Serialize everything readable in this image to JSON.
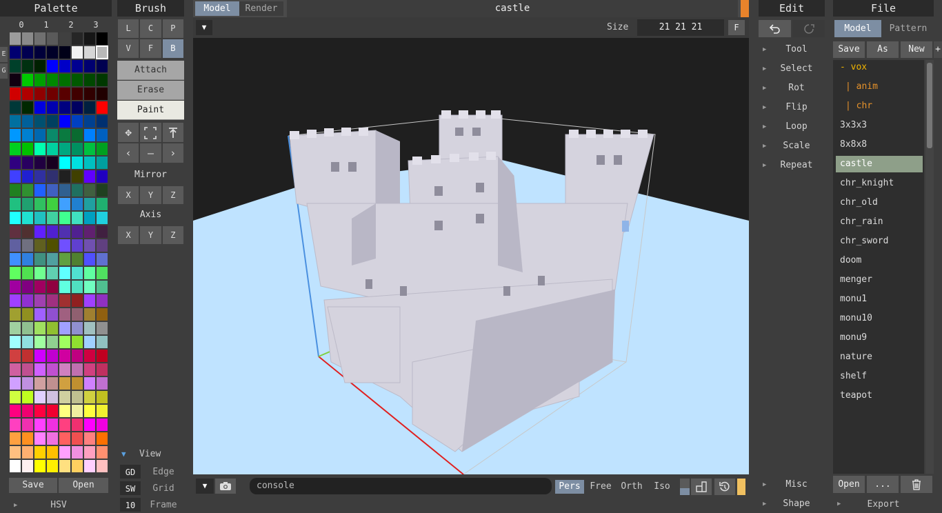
{
  "palette": {
    "title": "Palette",
    "tabs": [
      "0",
      "1",
      "2",
      "3"
    ],
    "side_tabs": [
      "E",
      "G"
    ],
    "colors": [
      "#9c9c9c",
      "#8a8a8a",
      "#707070",
      "#5a5a5a",
      "#404040",
      "#262626",
      "#161616",
      "#000000",
      "#000070",
      "#000050",
      "#00003a",
      "#000028",
      "#000018",
      "#f2f2f2",
      "#d6d6d6",
      "#b8b8b8",
      "#00402a",
      "#003010",
      "#002000",
      "#0000ff",
      "#0000c8",
      "#000090",
      "#000070",
      "#000050",
      "#100010",
      "#00c800",
      "#00a000",
      "#008800",
      "#007000",
      "#005800",
      "#004800",
      "#003800",
      "#d00000",
      "#b00000",
      "#900000",
      "#700000",
      "#580000",
      "#400000",
      "#300000",
      "#200000",
      "#003838",
      "#002800",
      "#0000e0",
      "#0000b0",
      "#000080",
      "#000060",
      "#002040",
      "#ff0000",
      "#0070a0",
      "#00609a",
      "#005070",
      "#004060",
      "#0000ff",
      "#0040c0",
      "#004090",
      "#003070",
      "#0098ff",
      "#0080d0",
      "#0068b0",
      "#0a8a6a",
      "#0a7a40",
      "#0a6a30",
      "#0080ff",
      "#0060c0",
      "#00d020",
      "#00c000",
      "#00ffb0",
      "#00d0a0",
      "#00a880",
      "#009060",
      "#00c040",
      "#00a020",
      "#300080",
      "#280060",
      "#200040",
      "#180020",
      "#00ffff",
      "#00e0e0",
      "#00c0c0",
      "#00a0a0",
      "#4040ff",
      "#2020d0",
      "#3030a0",
      "#303070",
      "#202020",
      "#404000",
      "#6000ff",
      "#2000c0",
      "#208020",
      "#309030",
      "#2060ff",
      "#4060c0",
      "#306090",
      "#207060",
      "#406040",
      "#204020",
      "#20c080",
      "#20a070",
      "#30c060",
      "#40d040",
      "#40a0ff",
      "#2080d0",
      "#20a0a0",
      "#20b070",
      "#20ffff",
      "#20e0d0",
      "#20c0c0",
      "#40d0a0",
      "#40ff90",
      "#40e0c0",
      "#00a0c0",
      "#20d0e0",
      "#603040",
      "#503030",
      "#6020ff",
      "#5020d0",
      "#5030b0",
      "#502090",
      "#602070",
      "#402040",
      "#6060a0",
      "#707080",
      "#606020",
      "#505000",
      "#7050ff",
      "#6040d0",
      "#7050b0",
      "#604080",
      "#4090ff",
      "#3080e0",
      "#409080",
      "#50a0a0",
      "#60a040",
      "#508030",
      "#5050ff",
      "#6070d0",
      "#60ff60",
      "#50e050",
      "#70ff90",
      "#60d0b0",
      "#60ffff",
      "#50e0d0",
      "#60ffa0",
      "#50e060",
      "#a000a0",
      "#800080",
      "#a00060",
      "#900040",
      "#60ffe0",
      "#50e0c0",
      "#70ffc0",
      "#50c090",
      "#a040ff",
      "#9030d0",
      "#a040b0",
      "#a03080",
      "#a03030",
      "#902020",
      "#a040ff",
      "#9030c0",
      "#a0a030",
      "#909020",
      "#a060ff",
      "#9050d0",
      "#a06080",
      "#906070",
      "#a08030",
      "#906010",
      "#a0d0a0",
      "#90c090",
      "#a0e060",
      "#90c030",
      "#a0a0ff",
      "#9090d0",
      "#a0c0c0",
      "#909090",
      "#a0ffff",
      "#90e0e0",
      "#a0ffa0",
      "#90d090",
      "#a0ff60",
      "#90e030",
      "#a0d0ff",
      "#90c0c0",
      "#d04040",
      "#c03030",
      "#d000ff",
      "#c000d0",
      "#d000a0",
      "#c00080",
      "#d00040",
      "#c00020",
      "#d060a0",
      "#c05090",
      "#d060ff",
      "#c050d0",
      "#d080c0",
      "#c070b0",
      "#d04080",
      "#c03060",
      "#d0a0ff",
      "#c090e0",
      "#d0a0a0",
      "#c09090",
      "#d0a040",
      "#c09030",
      "#d080ff",
      "#c070d0",
      "#d0ff40",
      "#c0ff20",
      "#e0d0ff",
      "#d0c0e0",
      "#d0d0a0",
      "#c0c090",
      "#d0d040",
      "#c0c020",
      "#ff0080",
      "#f00070",
      "#ff0040",
      "#f00030",
      "#ffff80",
      "#f0f0a0",
      "#ffff40",
      "#f0f030",
      "#ff40c0",
      "#f030b0",
      "#ff40ff",
      "#f030e0",
      "#ff4080",
      "#f03070",
      "#ff00ff",
      "#f000e0",
      "#ffa040",
      "#ff9020",
      "#ff80ff",
      "#f070e0",
      "#ff6060",
      "#f05050",
      "#ff8080",
      "#ff7000",
      "#ffc080",
      "#ffb070",
      "#ffd000",
      "#ffc000",
      "#ffa0ff",
      "#f090e0",
      "#ffa0c0",
      "#ff9070",
      "#ffffff",
      "#fff0f0",
      "#ffff00",
      "#fff000",
      "#ffe080",
      "#ffd060",
      "#ffd0ff",
      "#ffc0c0"
    ],
    "save_label": "Save",
    "open_label": "Open",
    "hsv_label": "HSV"
  },
  "brush": {
    "title": "Brush",
    "grid1": [
      "L",
      "C",
      "P",
      "V",
      "F",
      "B"
    ],
    "modes": [
      "Attach",
      "Erase",
      "Paint"
    ],
    "mirror_label": "Mirror",
    "axis_label": "Axis",
    "xyz": [
      "X",
      "Y",
      "Z"
    ],
    "view_label": "View",
    "view_rows": [
      {
        "key": "GD",
        "label": "Edge"
      },
      {
        "key": "SW",
        "label": "Grid"
      },
      {
        "key": "10",
        "label": "Frame"
      }
    ]
  },
  "viewport": {
    "tab_model": "Model",
    "tab_render": "Render",
    "title": "castle",
    "size_label": "Size",
    "size_value": "21 21 21",
    "f_button": "F",
    "console_placeholder": "console",
    "modes": [
      "Pers",
      "Free",
      "Orth",
      "Iso"
    ]
  },
  "edit": {
    "title": "Edit",
    "items": [
      "Tool",
      "Select",
      "Rot",
      "Flip",
      "Loop",
      "Scale",
      "Repeat"
    ],
    "bottom_items": [
      "Misc",
      "Shape"
    ]
  },
  "file": {
    "title": "File",
    "tab_model": "Model",
    "tab_pattern": "Pattern",
    "save_label": "Save",
    "as_label": "As",
    "new_label": "New",
    "plus_label": "+",
    "entries": [
      {
        "label": "- vox",
        "kind": "dir"
      },
      {
        "label": "| anim",
        "kind": "sub"
      },
      {
        "label": "| chr",
        "kind": "sub"
      },
      {
        "label": "3x3x3",
        "kind": "file"
      },
      {
        "label": "8x8x8",
        "kind": "file"
      },
      {
        "label": "castle",
        "kind": "selected"
      },
      {
        "label": "chr_knight",
        "kind": "file"
      },
      {
        "label": "chr_old",
        "kind": "file"
      },
      {
        "label": "chr_rain",
        "kind": "file"
      },
      {
        "label": "chr_sword",
        "kind": "file"
      },
      {
        "label": "doom",
        "kind": "file"
      },
      {
        "label": "menger",
        "kind": "file"
      },
      {
        "label": "monu1",
        "kind": "file"
      },
      {
        "label": "monu10",
        "kind": "file"
      },
      {
        "label": "monu9",
        "kind": "file"
      },
      {
        "label": "nature",
        "kind": "file"
      },
      {
        "label": "shelf",
        "kind": "file"
      },
      {
        "label": "teapot",
        "kind": "file"
      }
    ],
    "open_label": "Open",
    "dots_label": "...",
    "export_label": "Export"
  },
  "colors": {
    "accent": "#7d8ea3",
    "selected_file": "#8e9f89",
    "orange_marker": "#e8832b",
    "ground": "#bfe3ff",
    "voxel": "#d5d3de"
  }
}
